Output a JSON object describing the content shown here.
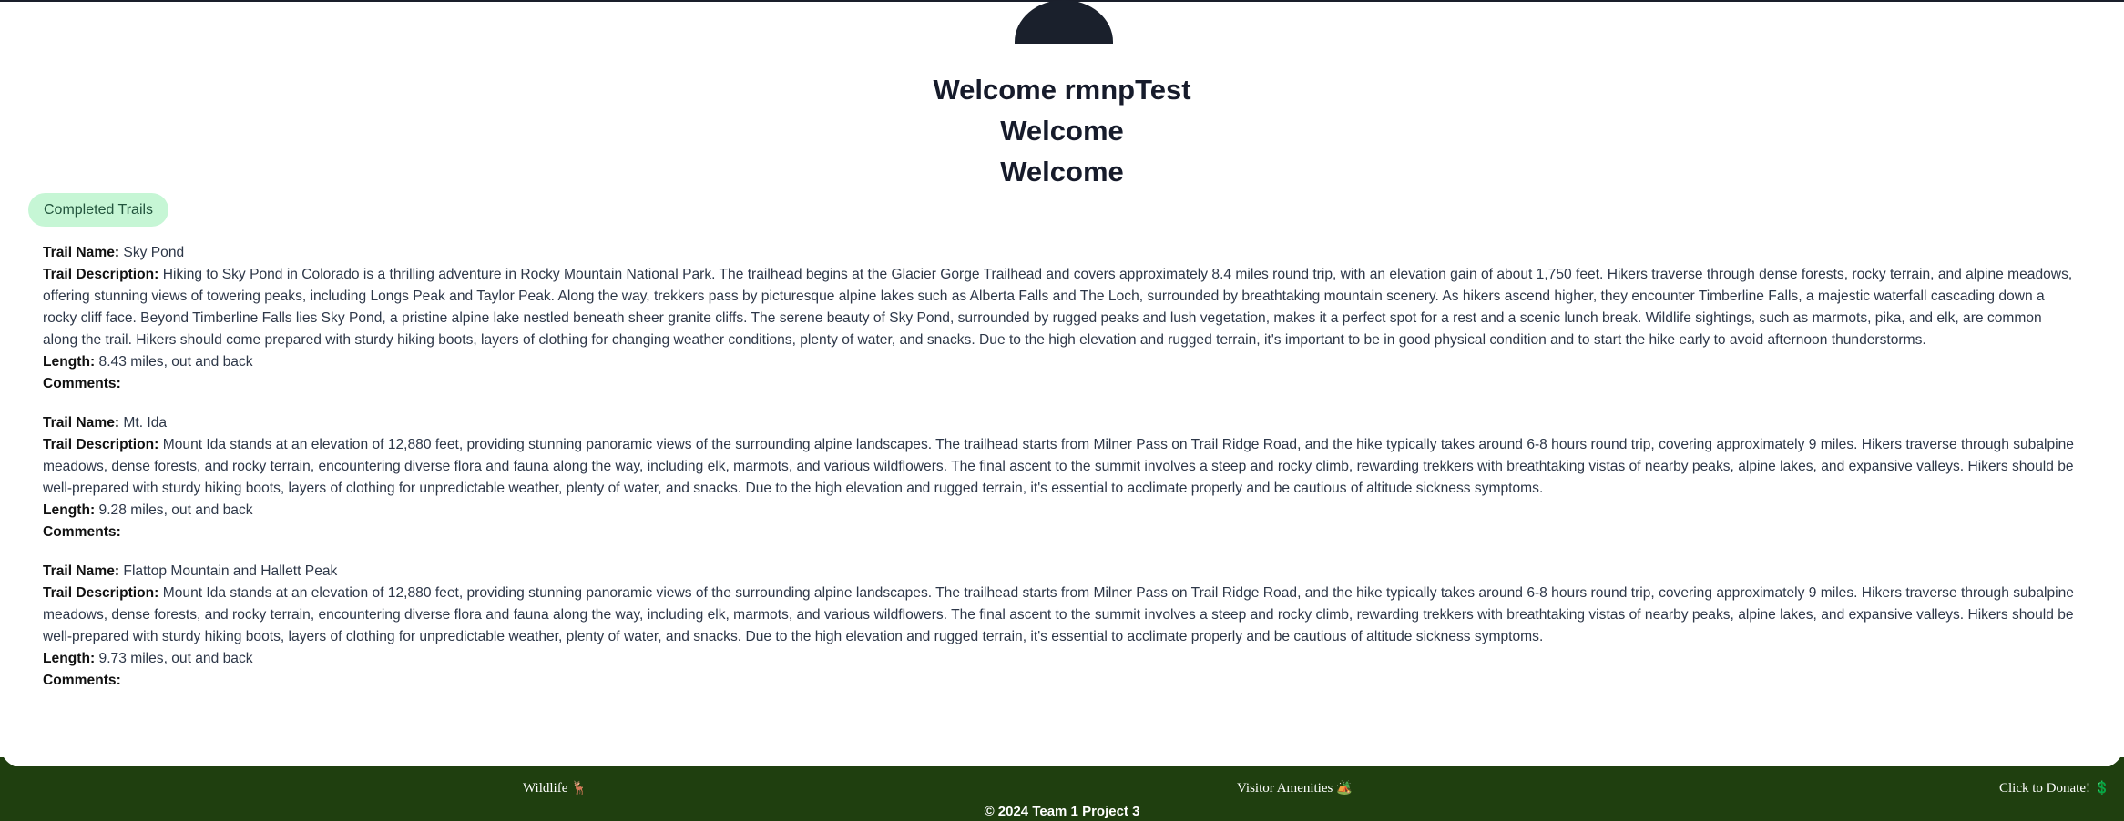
{
  "header": {
    "headings": [
      "Welcome rmnpTest",
      "Welcome",
      "Welcome"
    ]
  },
  "completed_label": "Completed Trails",
  "labels": {
    "name": "Trail Name:",
    "description": "Trail Description:",
    "length": "Length:",
    "comments": "Comments:"
  },
  "trails": [
    {
      "name": "Sky Pond",
      "description": "Hiking to Sky Pond in Colorado is a thrilling adventure in Rocky Mountain National Park. The trailhead begins at the Glacier Gorge Trailhead and covers approximately 8.4 miles round trip, with an elevation gain of about 1,750 feet. Hikers traverse through dense forests, rocky terrain, and alpine meadows, offering stunning views of towering peaks, including Longs Peak and Taylor Peak. Along the way, trekkers pass by picturesque alpine lakes such as Alberta Falls and The Loch, surrounded by breathtaking mountain scenery. As hikers ascend higher, they encounter Timberline Falls, a majestic waterfall cascading down a rocky cliff face. Beyond Timberline Falls lies Sky Pond, a pristine alpine lake nestled beneath sheer granite cliffs. The serene beauty of Sky Pond, surrounded by rugged peaks and lush vegetation, makes it a perfect spot for a rest and a scenic lunch break. Wildlife sightings, such as marmots, pika, and elk, are common along the trail. Hikers should come prepared with sturdy hiking boots, layers of clothing for changing weather conditions, plenty of water, and snacks. Due to the high elevation and rugged terrain, it's important to be in good physical condition and to start the hike early to avoid afternoon thunderstorms.",
      "length": "8.43 miles, out and back",
      "comments": ""
    },
    {
      "name": "Mt. Ida",
      "description": "Mount Ida stands at an elevation of 12,880 feet, providing stunning panoramic views of the surrounding alpine landscapes. The trailhead starts from Milner Pass on Trail Ridge Road, and the hike typically takes around 6-8 hours round trip, covering approximately 9 miles. Hikers traverse through subalpine meadows, dense forests, and rocky terrain, encountering diverse flora and fauna along the way, including elk, marmots, and various wildflowers. The final ascent to the summit involves a steep and rocky climb, rewarding trekkers with breathtaking vistas of nearby peaks, alpine lakes, and expansive valleys. Hikers should be well-prepared with sturdy hiking boots, layers of clothing for unpredictable weather, plenty of water, and snacks. Due to the high elevation and rugged terrain, it's essential to acclimate properly and be cautious of altitude sickness symptoms.",
      "length": "9.28 miles, out and back",
      "comments": ""
    },
    {
      "name": "Flattop Mountain and Hallett Peak",
      "description": "Mount Ida stands at an elevation of 12,880 feet, providing stunning panoramic views of the surrounding alpine landscapes. The trailhead starts from Milner Pass on Trail Ridge Road, and the hike typically takes around 6-8 hours round trip, covering approximately 9 miles. Hikers traverse through subalpine meadows, dense forests, and rocky terrain, encountering diverse flora and fauna along the way, including elk, marmots, and various wildflowers. The final ascent to the summit involves a steep and rocky climb, rewarding trekkers with breathtaking vistas of nearby peaks, alpine lakes, and expansive valleys. Hikers should be well-prepared with sturdy hiking boots, layers of clothing for unpredictable weather, plenty of water, and snacks. Due to the high elevation and rugged terrain, it's essential to acclimate properly and be cautious of altitude sickness symptoms.",
      "length": "9.73 miles, out and back",
      "comments": ""
    }
  ],
  "footer": {
    "wildlife": "Wildlife",
    "wildlife_icon": "🦌",
    "amenities": "Visitor Amenities",
    "amenities_icon": "🏕️",
    "donate": "Click to Donate!",
    "donate_icon": "💲",
    "copyright": "© 2024 Team 1 Project 3"
  },
  "colors": {
    "footer_bg": "#1f3f0f",
    "pill_bg": "#c6f6d5",
    "pill_text": "#22543d",
    "avatar": "#1a202c"
  }
}
